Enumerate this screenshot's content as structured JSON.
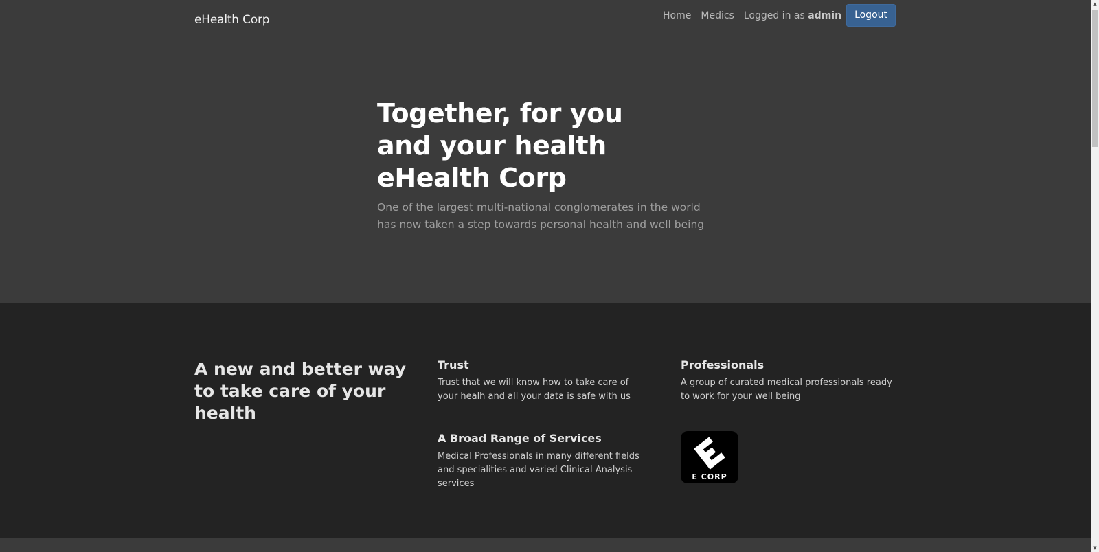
{
  "navbar": {
    "brand": "eHealth Corp",
    "links": [
      {
        "label": "Home"
      },
      {
        "label": "Medics"
      }
    ],
    "status_prefix": "Logged in as ",
    "username": "admin",
    "logout_label": "Logout"
  },
  "hero": {
    "title_line1": "Together, for you and your health",
    "title_line2": "eHealth Corp",
    "subtitle": "One of the largest multi-national conglomerates in the world has now taken a step towards personal health and well being"
  },
  "features": {
    "heading": "A new and better way to take care of your health",
    "items": [
      {
        "title": "Trust",
        "text": "Trust that we will know how to take care of your healh and all your data is safe with us"
      },
      {
        "title": "Professionals",
        "text": "A group of curated medical professionals ready to work for your well being"
      },
      {
        "title": "A Broad Range of Services",
        "text": "Medical Professionals in many different fields and specialities and varied Clinical Analysis services"
      }
    ],
    "logo_text": "E CORP"
  },
  "colors": {
    "hero_bg": "#3b3b3b",
    "features_bg": "#232323",
    "button_bg": "#386292"
  },
  "icons": {
    "logo": "ecorp-logo-icon",
    "scroll_up": "scroll-up-arrow-icon",
    "scroll_down": "scroll-down-arrow-icon"
  }
}
